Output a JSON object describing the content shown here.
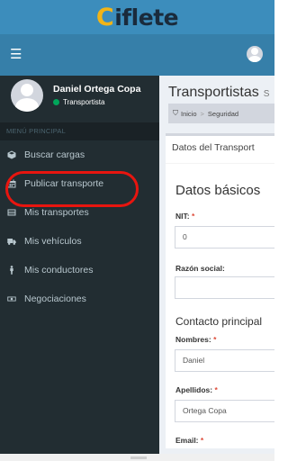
{
  "brand": {
    "logo_mark": "C",
    "logo_text": "iflete",
    "primary_color": "#3c8dbc",
    "accent_color": "#f2b417"
  },
  "topnav": {
    "menu_icon": "☰"
  },
  "user": {
    "name": "Daniel Ortega Copa",
    "role": "Transportista"
  },
  "sidebar": {
    "header": "MENÚ PRINCIPAL",
    "items": [
      {
        "label": "Buscar cargas",
        "icon": "cube-icon"
      },
      {
        "label": "Publicar transporte",
        "icon": "calendar-icon"
      },
      {
        "label": "Mis transportes",
        "icon": "list-icon"
      },
      {
        "label": "Mis vehículos",
        "icon": "truck-icon"
      },
      {
        "label": "Mis conductores",
        "icon": "male-icon"
      },
      {
        "label": "Negociaciones",
        "icon": "money-icon"
      }
    ]
  },
  "page": {
    "title": "Transportistas",
    "subtitle": "S"
  },
  "breadcrumb": {
    "home": "Inicio",
    "separator": ">",
    "current": "Seguridad"
  },
  "form": {
    "box_title": "Datos del Transport",
    "basic_section": "Datos básicos",
    "nit_label": "NIT:",
    "nit_value": "0",
    "razon_label": "Razón social:",
    "razon_value": "",
    "contact_section": "Contacto principal",
    "nombres_label": "Nombres:",
    "nombres_value": "Daniel",
    "apellidos_label": "Apellidos:",
    "apellidos_value": "Ortega Copa",
    "email_label": "Email:",
    "required_mark": "*"
  }
}
